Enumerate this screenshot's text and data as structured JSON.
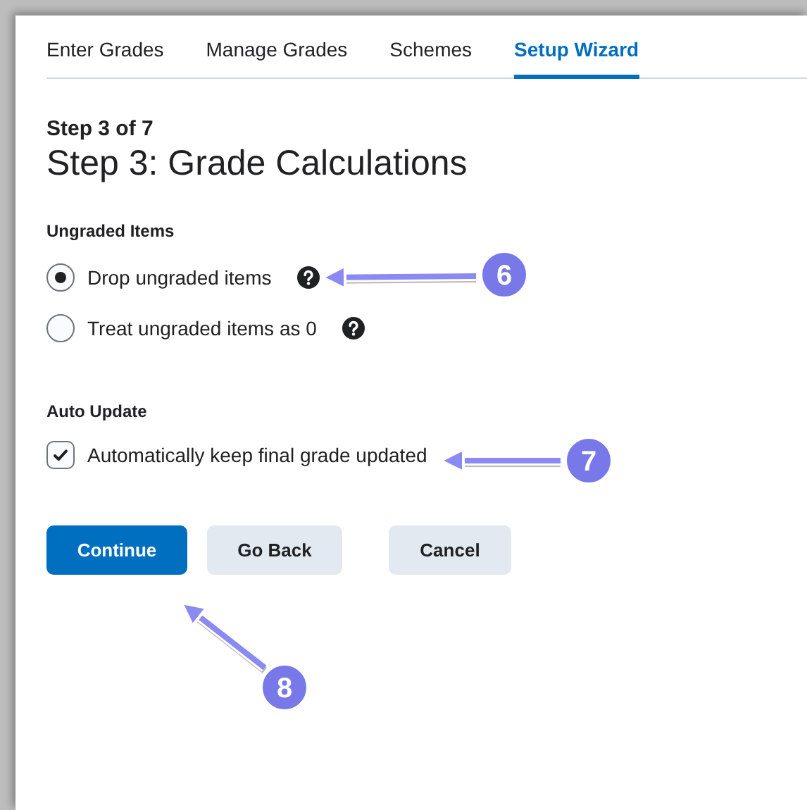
{
  "tabs": [
    {
      "label": "Enter Grades",
      "selected": false
    },
    {
      "label": "Manage Grades",
      "selected": false
    },
    {
      "label": "Schemes",
      "selected": false
    },
    {
      "label": "Setup Wizard",
      "selected": true
    }
  ],
  "step": "Step 3 of 7",
  "title": "Step 3: Grade Calculations",
  "ungraded": {
    "heading": "Ungraded Items",
    "options": [
      {
        "label": "Drop ungraded items",
        "selected": true
      },
      {
        "label": "Treat ungraded items as 0",
        "selected": false
      }
    ]
  },
  "auto_update": {
    "heading": "Auto Update",
    "label": "Automatically keep final grade updated",
    "checked": true
  },
  "buttons": [
    {
      "label": "Continue",
      "kind": "primary"
    },
    {
      "label": "Go Back",
      "kind": "secondary"
    },
    {
      "label": "Cancel",
      "kind": "secondary"
    }
  ],
  "callouts": [
    {
      "number": "6"
    },
    {
      "number": "7"
    },
    {
      "number": "8"
    }
  ]
}
